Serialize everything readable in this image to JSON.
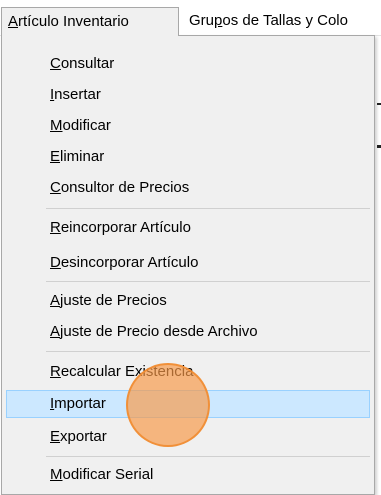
{
  "menubar": {
    "items": [
      {
        "pre": "",
        "key": "A",
        "post": "rtículo Inventario"
      },
      {
        "pre": "Gru",
        "key": "p",
        "post": "os de Tallas y Colo"
      }
    ]
  },
  "menu": {
    "items": [
      {
        "pre": "",
        "key": "C",
        "post": "onsultar"
      },
      {
        "pre": "",
        "key": "I",
        "post": "nsertar"
      },
      {
        "pre": "",
        "key": "M",
        "post": "odificar"
      },
      {
        "pre": "",
        "key": "E",
        "post": "liminar"
      },
      {
        "pre": "",
        "key": "C",
        "post": "onsultor de Precios"
      },
      {
        "pre": "",
        "key": "R",
        "post": "eincorporar Artículo"
      },
      {
        "pre": "",
        "key": "D",
        "post": "esincorporar Artículo"
      },
      {
        "pre": "",
        "key": "A",
        "post": "juste de Precios"
      },
      {
        "pre": "",
        "key": "A",
        "post": "juste de Precio desde Archivo"
      },
      {
        "pre": "",
        "key": "R",
        "post": "ecalcular Existencia"
      },
      {
        "pre": "",
        "key": "I",
        "post": "mportar"
      },
      {
        "pre": "",
        "key": "E",
        "post": "xportar"
      },
      {
        "pre": "",
        "key": "M",
        "post": "odificar Serial"
      }
    ]
  },
  "colors": {
    "highlight_bg": "#cce8ff",
    "highlight_border": "#99d1ff",
    "click_indicator": "#f79a48"
  }
}
